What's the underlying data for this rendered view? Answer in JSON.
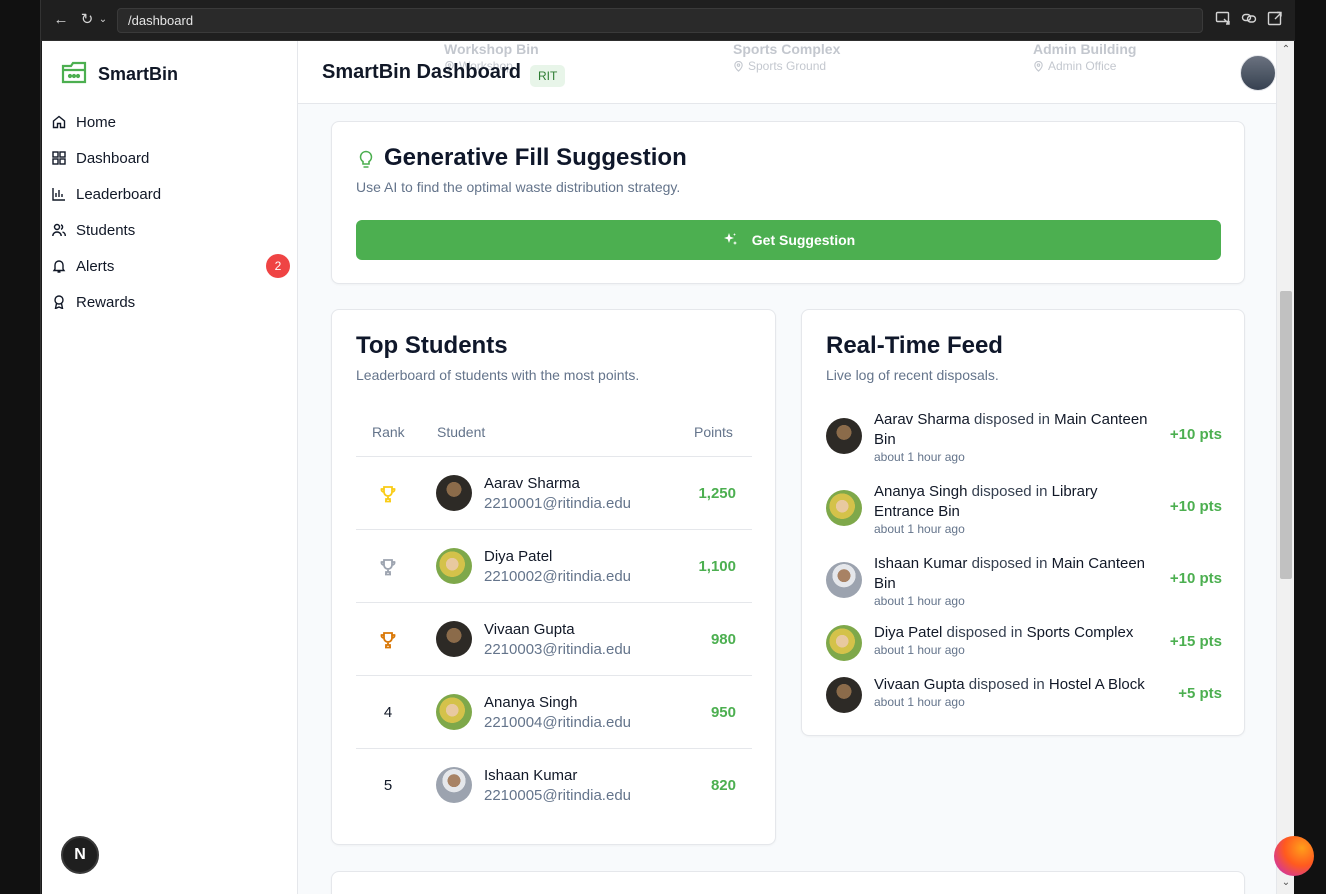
{
  "browser": {
    "url": "/dashboard"
  },
  "sidebar": {
    "brand": "SmartBin",
    "items": [
      {
        "label": "Home",
        "icon": "home-icon"
      },
      {
        "label": "Dashboard",
        "icon": "grid-icon"
      },
      {
        "label": "Leaderboard",
        "icon": "bar-chart-icon"
      },
      {
        "label": "Students",
        "icon": "users-icon"
      },
      {
        "label": "Alerts",
        "icon": "bell-icon",
        "badge": "2"
      },
      {
        "label": "Rewards",
        "icon": "award-icon"
      }
    ],
    "dev_button": "N"
  },
  "header": {
    "title": "SmartBin Dashboard",
    "badge": "RIT",
    "background_bins": [
      {
        "name": "Workshop Bin",
        "location": "Workshop"
      },
      {
        "name": "Sports Complex",
        "location": "Sports Ground"
      },
      {
        "name": "Admin Building",
        "location": "Admin Office"
      }
    ]
  },
  "suggestion": {
    "title": "Generative Fill Suggestion",
    "subtitle": "Use AI to find the optimal waste distribution strategy.",
    "button_label": "Get Suggestion"
  },
  "top_students": {
    "title": "Top Students",
    "subtitle": "Leaderboard of students with the most points.",
    "columns": [
      "Rank",
      "Student",
      "Points"
    ],
    "rows": [
      {
        "rank": "1",
        "rank_icon": "trophy-gold-icon",
        "name": "Aarav Sharma",
        "email": "2210001@ritindia.edu",
        "points": "1,250"
      },
      {
        "rank": "2",
        "rank_icon": "trophy-silver-icon",
        "name": "Diya Patel",
        "email": "2210002@ritindia.edu",
        "points": "1,100"
      },
      {
        "rank": "3",
        "rank_icon": "trophy-bronze-icon",
        "name": "Vivaan Gupta",
        "email": "2210003@ritindia.edu",
        "points": "980"
      },
      {
        "rank": "4",
        "name": "Ananya Singh",
        "email": "2210004@ritindia.edu",
        "points": "950"
      },
      {
        "rank": "5",
        "name": "Ishaan Kumar",
        "email": "2210005@ritindia.edu",
        "points": "820"
      }
    ]
  },
  "feed": {
    "title": "Real-Time Feed",
    "subtitle": "Live log of recent disposals.",
    "verb": "disposed in",
    "items": [
      {
        "name": "Aarav Sharma",
        "bin": "Main Canteen Bin",
        "time": "about 1 hour ago",
        "points": "+10 pts"
      },
      {
        "name": "Ananya Singh",
        "bin": "Library Entrance Bin",
        "time": "about 1 hour ago",
        "points": "+10 pts"
      },
      {
        "name": "Ishaan Kumar",
        "bin": "Main Canteen Bin",
        "time": "about 1 hour ago",
        "points": "+10 pts"
      },
      {
        "name": "Diya Patel",
        "bin": "Sports Complex",
        "time": "about 1 hour ago",
        "points": "+15 pts"
      },
      {
        "name": "Vivaan Gupta",
        "bin": "Hostel A Block",
        "time": "about 1 hour ago",
        "points": "+5 pts"
      }
    ]
  },
  "colors": {
    "accent_green": "#4caf50",
    "alert_red": "#ef4444",
    "gold": "#facc15",
    "silver": "#9ca3af",
    "bronze": "#d97706"
  }
}
